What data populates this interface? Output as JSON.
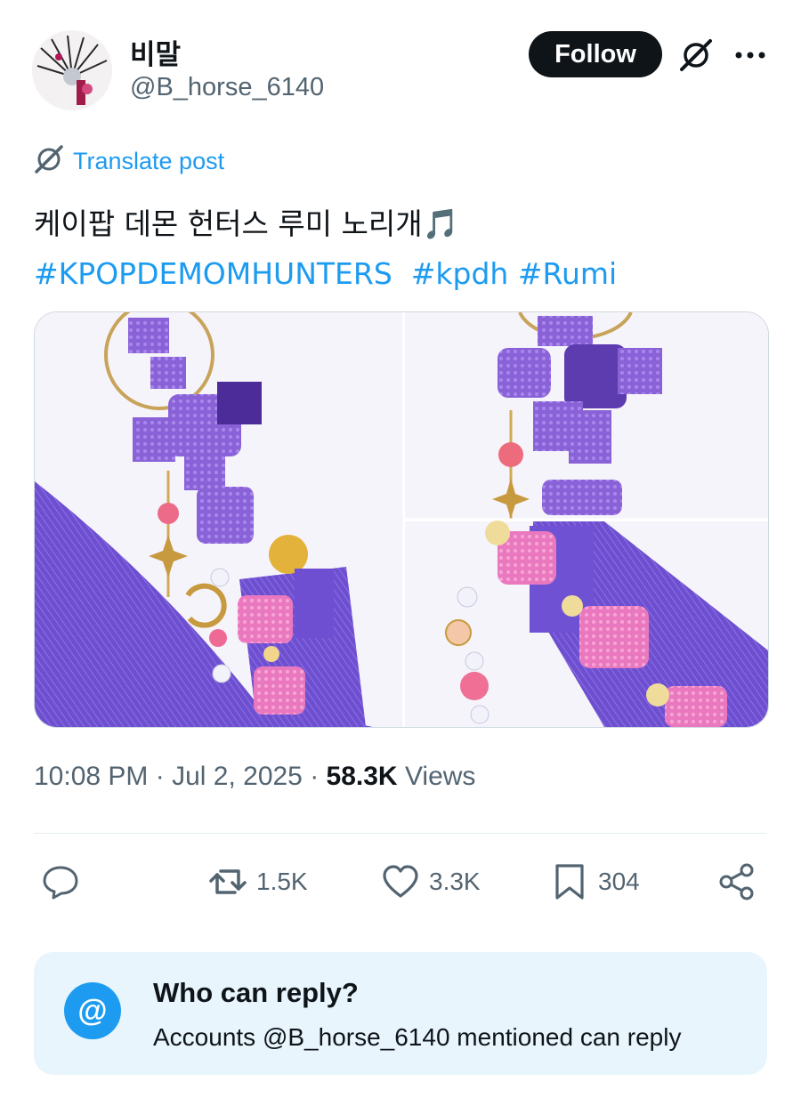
{
  "author": {
    "display_name": "비말",
    "handle": "@B_horse_6140"
  },
  "header": {
    "follow_label": "Follow"
  },
  "translate_label": "Translate post",
  "post": {
    "text": "케이팝 데몬 헌터스 루미 노리개",
    "emoji": "🎵",
    "hashtags": [
      "#KPOPDEMOMHUNTERS",
      "#kpdh",
      "#Rumi"
    ]
  },
  "meta": {
    "time": "10:08 PM",
    "date": "Jul 2, 2025",
    "views_count": "58.3K",
    "views_label": "Views"
  },
  "actions": {
    "reposts": "1.5K",
    "likes": "3.3K",
    "bookmarks": "304"
  },
  "reply_settings": {
    "icon_glyph": "@",
    "title": "Who can reply?",
    "subtitle": "Accounts @B_horse_6140 mentioned can reply"
  },
  "icons": [
    "grok-icon",
    "more-icon",
    "translate-icon",
    "reply-icon",
    "repost-icon",
    "like-icon",
    "bookmark-icon",
    "share-icon",
    "at-icon"
  ],
  "colors": {
    "accent": "#1d9bf0",
    "text": "#0f1419",
    "muted": "#536471",
    "reply_box_bg": "#e8f5fd",
    "knot_purple": "#8b63d9",
    "knot_pink": "#ef7fc4"
  }
}
